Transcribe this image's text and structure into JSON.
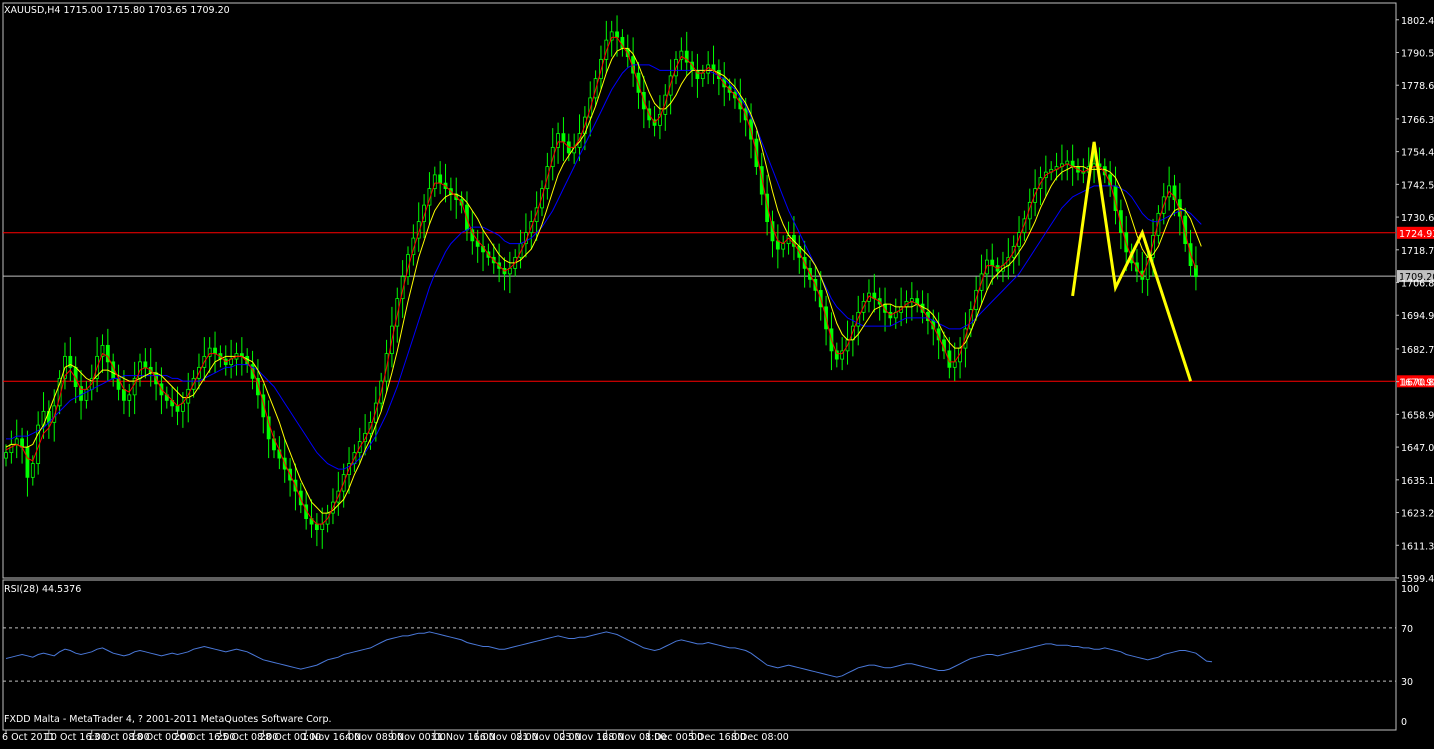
{
  "chart_data": [
    {
      "type": "candlestick",
      "symbol_header": "XAUUSD,H4  1715.00 1715.80 1703.65 1709.20",
      "ylim": [
        1599.4,
        1808.5
      ],
      "price_ticks": [
        "1802.40",
        "1790.50",
        "1778.60",
        "1766.35",
        "1754.45",
        "1742.55",
        "1730.65",
        "1718.75",
        "1706.85",
        "1694.95",
        "1682.70",
        "1670.80",
        "1658.90",
        "1647.00",
        "1635.10",
        "1623.20",
        "1611.30",
        "1599.40"
      ],
      "x_labels": [
        "6 Oct 2011",
        "10 Oct 16:00",
        "13 Oct 08:00",
        "18 Oct 00:00",
        "20 Oct 16:00",
        "25 Oct 08:00",
        "28 Oct 00:00",
        "1 Nov 16:00",
        "4 Nov 08:00",
        "9 Nov 00:00",
        "11 Nov 16:00",
        "16 Nov 08:00",
        "21 Nov 00:00",
        "23 Nov 16:00",
        "28 Nov 08:00",
        "1 Dec 00:00",
        "5 Dec 16:00",
        "8 Dec 08:00"
      ],
      "x_label_index": [
        0,
        8,
        16,
        24,
        32,
        40,
        48,
        56,
        64,
        72,
        80,
        88,
        96,
        104,
        112,
        120,
        128,
        136
      ],
      "closes": [
        1645,
        1648,
        1650,
        1647,
        1636,
        1641,
        1655,
        1660,
        1656,
        1662,
        1672,
        1680,
        1676,
        1669,
        1664,
        1668,
        1672,
        1680,
        1684,
        1678,
        1672,
        1668,
        1664,
        1666,
        1672,
        1678,
        1676,
        1674,
        1670,
        1666,
        1664,
        1662,
        1660,
        1663,
        1668,
        1672,
        1676,
        1680,
        1683,
        1681,
        1679,
        1677,
        1679,
        1681,
        1680,
        1677,
        1672,
        1666,
        1658,
        1650,
        1646,
        1643,
        1639,
        1635,
        1631,
        1626,
        1621,
        1619,
        1617,
        1619,
        1623,
        1627,
        1631,
        1637,
        1641,
        1645,
        1649,
        1652,
        1656,
        1663,
        1671,
        1681,
        1691,
        1701,
        1709,
        1717,
        1723,
        1729,
        1735,
        1741,
        1746,
        1743,
        1741,
        1739,
        1737,
        1735,
        1726,
        1722,
        1720,
        1718,
        1716,
        1714,
        1712,
        1710,
        1712,
        1716,
        1721,
        1725,
        1729,
        1734,
        1741,
        1749,
        1756,
        1761,
        1758,
        1754,
        1756,
        1761,
        1767,
        1774,
        1781,
        1788,
        1795,
        1798,
        1796,
        1792,
        1789,
        1783,
        1776,
        1770,
        1766,
        1764,
        1768,
        1775,
        1782,
        1788,
        1791,
        1787,
        1784,
        1781,
        1783,
        1786,
        1784,
        1781,
        1778,
        1776,
        1774,
        1770,
        1766,
        1759,
        1749,
        1739,
        1729,
        1722,
        1719,
        1721,
        1724,
        1720,
        1716,
        1712,
        1708,
        1704,
        1698,
        1690,
        1682,
        1679,
        1682,
        1686,
        1691,
        1696,
        1700,
        1703,
        1701,
        1699,
        1696,
        1694,
        1696,
        1698,
        1700,
        1701,
        1699,
        1696,
        1693,
        1690,
        1686,
        1682,
        1676,
        1678,
        1683,
        1690,
        1697,
        1704,
        1710,
        1715,
        1713,
        1711,
        1713,
        1716,
        1720,
        1725,
        1730,
        1736,
        1741,
        1745,
        1747,
        1748,
        1749,
        1750,
        1751,
        1749,
        1747,
        1747,
        1749,
        1750,
        1749,
        1746,
        1742,
        1733,
        1725,
        1718,
        1714,
        1711,
        1708,
        1716,
        1724,
        1732,
        1738,
        1742,
        1737,
        1731,
        1721,
        1713,
        1709
      ],
      "sma_fast": [
        1647,
        1648,
        1648,
        1647,
        1647,
        1648,
        1652,
        1655,
        1660,
        1665,
        1670,
        1676,
        1677,
        1676,
        1674,
        1672,
        1671,
        1673,
        1675,
        1675,
        1674,
        1673,
        1672,
        1671,
        1671,
        1672,
        1673,
        1674,
        1674,
        1673,
        1671,
        1669,
        1667,
        1665,
        1665,
        1666,
        1669,
        1672,
        1675,
        1678,
        1679,
        1680,
        1680,
        1680,
        1680,
        1679,
        1678,
        1675,
        1671,
        1666,
        1661,
        1656,
        1650,
        1645,
        1640,
        1635,
        1631,
        1627,
        1625,
        1623,
        1623,
        1624,
        1626,
        1628,
        1632,
        1637,
        1641,
        1646,
        1650,
        1655,
        1660,
        1667,
        1674,
        1682,
        1691,
        1700,
        1708,
        1716,
        1722,
        1728,
        1733,
        1736,
        1738,
        1739,
        1739,
        1738,
        1736,
        1733,
        1730,
        1726,
        1723,
        1720,
        1717,
        1715,
        1714,
        1714,
        1715,
        1717,
        1719,
        1723,
        1728,
        1734,
        1740,
        1746,
        1750,
        1753,
        1756,
        1758,
        1761,
        1766,
        1771,
        1777,
        1783,
        1788,
        1791,
        1792,
        1792,
        1790,
        1786,
        1781,
        1776,
        1772,
        1770,
        1770,
        1772,
        1775,
        1779,
        1782,
        1784,
        1784,
        1784,
        1784,
        1784,
        1783,
        1782,
        1780,
        1778,
        1775,
        1772,
        1768,
        1763,
        1756,
        1748,
        1740,
        1733,
        1728,
        1724,
        1722,
        1720,
        1718,
        1716,
        1713,
        1709,
        1704,
        1698,
        1692,
        1688,
        1686,
        1686,
        1688,
        1691,
        1694,
        1697,
        1698,
        1699,
        1699,
        1698,
        1698,
        1698,
        1698,
        1699,
        1698,
        1697,
        1695,
        1692,
        1688,
        1685,
        1683,
        1683,
        1685,
        1689,
        1694,
        1699,
        1704,
        1708,
        1710,
        1712,
        1713,
        1715,
        1718,
        1721,
        1725,
        1729,
        1734,
        1738,
        1742,
        1745,
        1747,
        1748,
        1749,
        1749,
        1749,
        1748,
        1748,
        1748,
        1748,
        1747,
        1745,
        1741,
        1736,
        1730,
        1724,
        1719,
        1716,
        1717,
        1720,
        1725,
        1730,
        1733,
        1734,
        1733,
        1730,
        1725,
        1720
      ],
      "sma_slow": [
        1650,
        1650,
        1651,
        1651,
        1651,
        1652,
        1653,
        1654,
        1656,
        1658,
        1660,
        1662,
        1664,
        1665,
        1666,
        1667,
        1668,
        1669,
        1670,
        1671,
        1672,
        1672,
        1673,
        1673,
        1673,
        1673,
        1673,
        1673,
        1673,
        1673,
        1673,
        1672,
        1672,
        1671,
        1671,
        1671,
        1671,
        1672,
        1673,
        1674,
        1675,
        1676,
        1676,
        1677,
        1677,
        1677,
        1676,
        1675,
        1673,
        1671,
        1669,
        1666,
        1663,
        1660,
        1657,
        1654,
        1651,
        1648,
        1645,
        1643,
        1641,
        1640,
        1639,
        1639,
        1640,
        1641,
        1643,
        1645,
        1648,
        1651,
        1655,
        1659,
        1664,
        1669,
        1675,
        1681,
        1687,
        1693,
        1699,
        1705,
        1710,
        1714,
        1718,
        1721,
        1723,
        1725,
        1726,
        1727,
        1727,
        1727,
        1726,
        1725,
        1724,
        1722,
        1721,
        1721,
        1721,
        1722,
        1723,
        1725,
        1727,
        1730,
        1733,
        1737,
        1741,
        1745,
        1749,
        1753,
        1757,
        1761,
        1765,
        1769,
        1773,
        1777,
        1780,
        1783,
        1785,
        1786,
        1786,
        1786,
        1786,
        1785,
        1784,
        1784,
        1784,
        1784,
        1784,
        1784,
        1784,
        1784,
        1784,
        1784,
        1783,
        1782,
        1781,
        1779,
        1777,
        1774,
        1771,
        1767,
        1763,
        1758,
        1753,
        1748,
        1743,
        1738,
        1733,
        1729,
        1725,
        1721,
        1717,
        1713,
        1709,
        1705,
        1701,
        1698,
        1696,
        1694,
        1693,
        1692,
        1691,
        1691,
        1691,
        1691,
        1691,
        1691,
        1692,
        1693,
        1694,
        1694,
        1694,
        1694,
        1694,
        1693,
        1692,
        1691,
        1690,
        1690,
        1690,
        1691,
        1692,
        1694,
        1696,
        1698,
        1700,
        1702,
        1704,
        1706,
        1708,
        1710,
        1713,
        1716,
        1719,
        1722,
        1725,
        1728,
        1731,
        1734,
        1736,
        1738,
        1739,
        1740,
        1741,
        1742,
        1742,
        1742,
        1742,
        1742,
        1741,
        1740,
        1738,
        1735,
        1732,
        1730,
        1729,
        1729,
        1730,
        1731,
        1732,
        1733,
        1733,
        1732,
        1730,
        1728
      ],
      "ema_red": [
        1646,
        1647,
        1648,
        1647,
        1643,
        1642,
        1647,
        1652,
        1654,
        1658,
        1665,
        1673,
        1675,
        1672,
        1668,
        1668,
        1670,
        1676,
        1681,
        1680,
        1676,
        1672,
        1668,
        1667,
        1670,
        1675,
        1676,
        1675,
        1672,
        1668,
        1666,
        1664,
        1662,
        1663,
        1666,
        1670,
        1674,
        1678,
        1681,
        1681,
        1680,
        1678,
        1679,
        1680,
        1680,
        1678,
        1675,
        1670,
        1663,
        1656,
        1650,
        1646,
        1641,
        1637,
        1633,
        1628,
        1624,
        1621,
        1619,
        1619,
        1621,
        1625,
        1629,
        1634,
        1639,
        1643,
        1647,
        1650,
        1654,
        1660,
        1667,
        1676,
        1686,
        1695,
        1704,
        1712,
        1719,
        1725,
        1731,
        1737,
        1743,
        1743,
        1742,
        1740,
        1738,
        1736,
        1730,
        1725,
        1722,
        1720,
        1717,
        1715,
        1713,
        1711,
        1712,
        1714,
        1718,
        1722,
        1727,
        1732,
        1738,
        1745,
        1752,
        1758,
        1758,
        1756,
        1756,
        1759,
        1764,
        1770,
        1777,
        1784,
        1791,
        1796,
        1796,
        1793,
        1790,
        1785,
        1779,
        1773,
        1768,
        1765,
        1767,
        1772,
        1779,
        1785,
        1789,
        1788,
        1786,
        1783,
        1783,
        1785,
        1784,
        1782,
        1779,
        1777,
        1775,
        1772,
        1768,
        1762,
        1754,
        1745,
        1735,
        1727,
        1722,
        1721,
        1723,
        1721,
        1718,
        1714,
        1710,
        1706,
        1701,
        1694,
        1686,
        1681,
        1681,
        1684,
        1689,
        1694,
        1698,
        1702,
        1701,
        1700,
        1697,
        1695,
        1696,
        1697,
        1699,
        1700,
        1699,
        1697,
        1694,
        1691,
        1687,
        1683,
        1678,
        1678,
        1681,
        1687,
        1694,
        1701,
        1707,
        1713,
        1713,
        1712,
        1713,
        1715,
        1718,
        1723,
        1728,
        1734,
        1739,
        1743,
        1746,
        1747,
        1748,
        1749,
        1750,
        1749,
        1748,
        1747,
        1748,
        1749,
        1749,
        1747,
        1743,
        1736,
        1728,
        1721,
        1716,
        1712,
        1709,
        1714,
        1721,
        1729,
        1735,
        1740,
        1738,
        1733,
        1725,
        1717,
        1712
      ],
      "pattern_line": [
        [
          199,
          1702
        ],
        [
          203,
          1758
        ],
        [
          207,
          1705
        ],
        [
          212,
          1725
        ],
        [
          221,
          1671
        ]
      ],
      "hlines": [
        {
          "price": 1724.93,
          "label": "1724.93",
          "color": "#ff0000"
        },
        {
          "price": 1709.2,
          "label": "1709.20",
          "color": "#c0c0c0"
        },
        {
          "price": 1670.93,
          "label": "1670.93",
          "color": "#ff0000"
        }
      ],
      "colors": {
        "candle": "#00ff00",
        "sma_fast": "#ffff00",
        "sma_slow": "#0000ff",
        "ema_red": "#ff0000",
        "pattern": "#ffff00",
        "axis": "#c0c0c0"
      }
    },
    {
      "type": "line",
      "label": "RSI(28) 44.5376",
      "ylim": [
        0,
        100
      ],
      "ticks": [
        "100",
        "70",
        "30",
        "0"
      ],
      "levels": [
        70,
        30
      ],
      "color": "#4a78d8",
      "values": [
        47,
        48,
        49,
        50,
        49,
        48,
        50,
        51,
        50,
        49,
        52,
        54,
        53,
        51,
        50,
        51,
        52,
        54,
        55,
        53,
        51,
        50,
        49,
        50,
        52,
        53,
        52,
        51,
        50,
        49,
        50,
        51,
        50,
        51,
        52,
        54,
        55,
        56,
        55,
        54,
        53,
        52,
        53,
        54,
        53,
        52,
        50,
        48,
        46,
        45,
        44,
        43,
        42,
        41,
        40,
        39,
        40,
        41,
        42,
        44,
        46,
        47,
        48,
        50,
        51,
        52,
        53,
        54,
        55,
        57,
        59,
        61,
        62,
        63,
        64,
        64,
        65,
        66,
        66,
        67,
        66,
        65,
        64,
        63,
        62,
        61,
        59,
        58,
        57,
        56,
        56,
        55,
        54,
        54,
        55,
        56,
        57,
        58,
        59,
        60,
        61,
        62,
        63,
        64,
        63,
        62,
        62,
        63,
        63,
        64,
        65,
        66,
        67,
        66,
        65,
        63,
        61,
        59,
        57,
        55,
        54,
        53,
        54,
        56,
        58,
        60,
        61,
        60,
        59,
        58,
        58,
        59,
        58,
        57,
        56,
        55,
        55,
        54,
        53,
        51,
        48,
        45,
        42,
        41,
        40,
        41,
        42,
        41,
        40,
        39,
        38,
        37,
        36,
        35,
        34,
        33,
        34,
        36,
        38,
        40,
        41,
        42,
        42,
        41,
        40,
        40,
        41,
        42,
        43,
        43,
        42,
        41,
        40,
        39,
        38,
        38,
        39,
        41,
        43,
        45,
        47,
        48,
        49,
        50,
        50,
        49,
        50,
        51,
        52,
        53,
        54,
        55,
        56,
        57,
        58,
        58,
        57,
        57,
        57,
        56,
        56,
        55,
        55,
        54,
        54,
        55,
        54,
        53,
        52,
        50,
        49,
        48,
        47,
        46,
        47,
        48,
        50,
        51,
        52,
        53,
        53,
        52,
        51,
        48,
        45,
        44.5
      ]
    }
  ],
  "footer": {
    "copyright": "FXDD Malta - MetaTrader 4, ? 2001-2011 MetaQuotes Software Corp."
  }
}
